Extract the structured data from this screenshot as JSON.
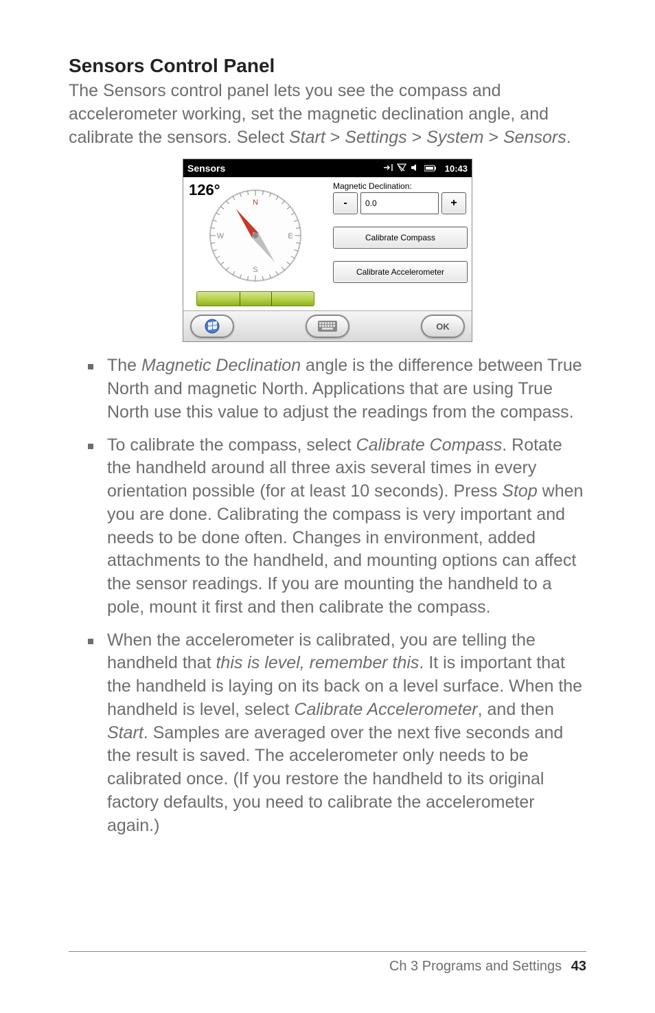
{
  "heading": "Sensors Control Panel",
  "intro": {
    "pre": "The Sensors control panel lets you see the compass and accelerometer working, set the magnetic declination angle, and calibrate the sensors. Select ",
    "path1": "Start",
    "sep1": " > ",
    "path2": "Settings",
    "sep2": " > ",
    "path3": "System",
    "sep3": " > ",
    "path4": "Sensors",
    "tail": "."
  },
  "device": {
    "title": "Sensors",
    "clock": "10:43",
    "heading_reading": "126°",
    "compass": {
      "N": "N",
      "E": "E",
      "S": "S",
      "W": "W"
    },
    "declination_label": "Magnetic Declination:",
    "declination_value": "0.0",
    "minus": "-",
    "plus": "+",
    "calibrate_compass": "Calibrate Compass",
    "calibrate_accel": "Calibrate Accelerometer",
    "ok": "OK"
  },
  "bullets": {
    "b1": {
      "t1": "The ",
      "em1": "Magnetic Declination",
      "t2": " angle is the difference between True North and magnetic North. Applications that are using True North use this value to adjust the readings from the compass."
    },
    "b2": {
      "t1": "To calibrate the compass, select ",
      "em1": "Calibrate Compass",
      "t2": ". Rotate the handheld around all three axis several times in every orientation possible (for at least 10 seconds). Press ",
      "em2": "Stop",
      "t3": " when you are done. Calibrating the compass is very important and needs to be done often. Changes in environment, added attachments to the handheld, and mounting options can affect the sensor readings. If you are mounting the handheld to a pole, mount it first and then calibrate the compass."
    },
    "b3": {
      "t1": "When the accelerometer is calibrated, you are telling the handheld that ",
      "em1": "this is level, remember this",
      "t2": ". It is important that the handheld is laying on its back on a level surface. When the handheld is level, select ",
      "em2": "Calibrate Accelerometer",
      "t3": ", and then ",
      "em3": "Start",
      "t4": ". Samples are averaged over the next five seconds and the result is saved. The accelerometer only needs to be calibrated once. (If you restore the handheld to its original factory defaults, you need to calibrate the accelerometer again.)"
    }
  },
  "footer": {
    "chapter": "Ch 3   Programs and Settings",
    "page": "43"
  }
}
